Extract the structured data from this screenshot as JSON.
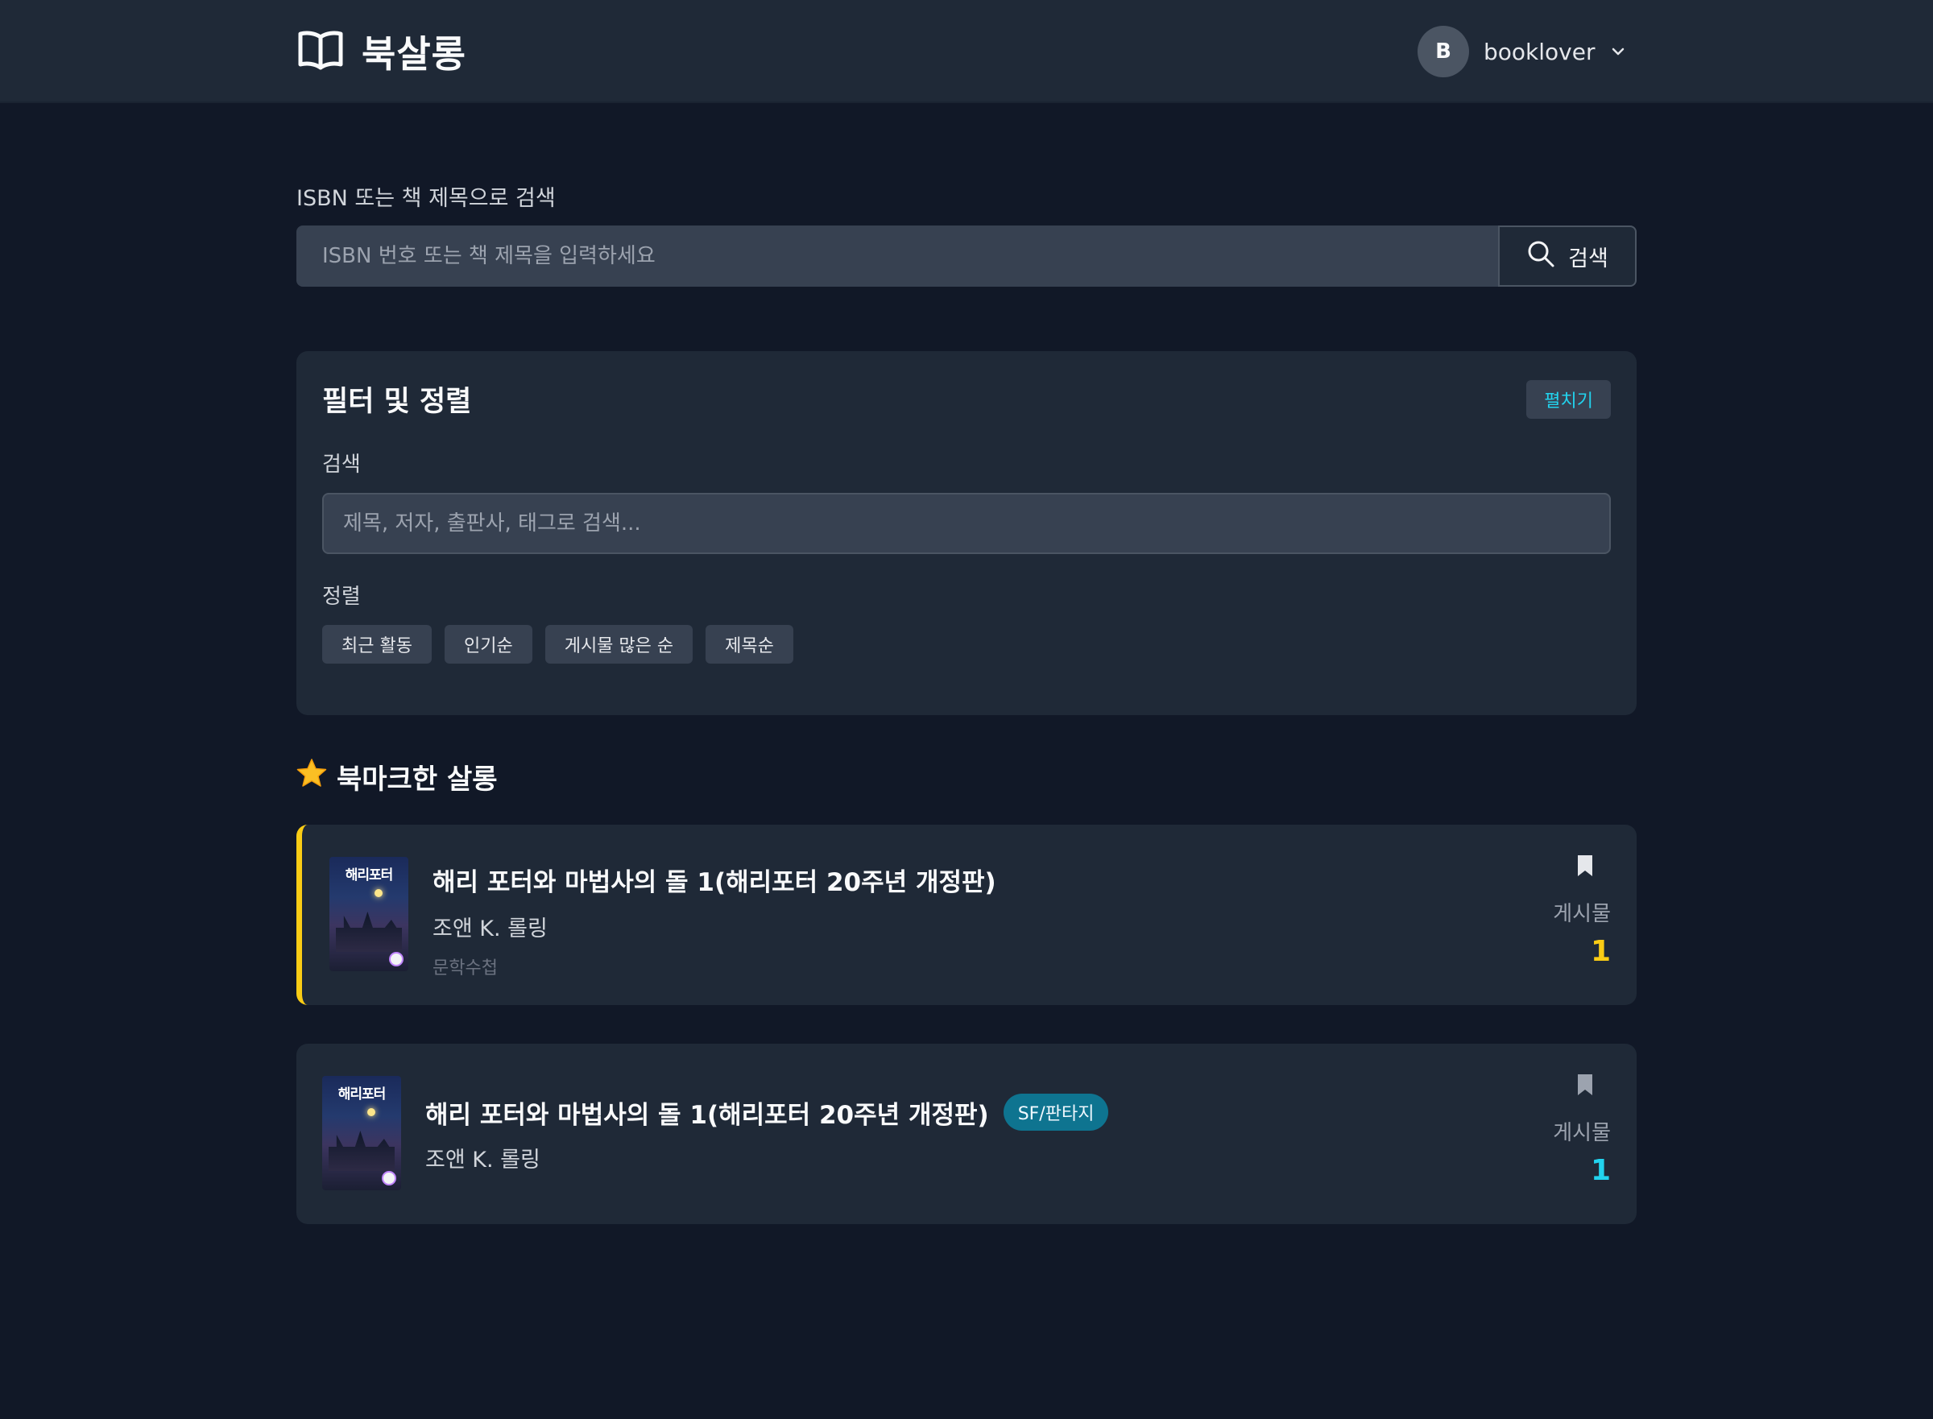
{
  "app": {
    "name": "북살롱"
  },
  "user": {
    "avatar_initial": "B",
    "name": "booklover"
  },
  "isbn_search": {
    "label": "ISBN 또는 책 제목으로 검색",
    "placeholder": "ISBN 번호 또는 책 제목을 입력하세요",
    "value": "",
    "button_label": "검색"
  },
  "filter": {
    "title": "필터 및 정렬",
    "expand_label": "펼치기",
    "search_label": "검색",
    "search_placeholder": "제목, 저자, 출판사, 태그로 검색...",
    "sort_label": "정렬",
    "sort_options": [
      "최근 활동",
      "인기순",
      "게시물 많은 순",
      "제목순"
    ]
  },
  "bookmarked_section": {
    "title": "북마크한 살롱"
  },
  "salons": [
    {
      "title": "해리 포터와 마법사의 돌 1(해리포터 20주년 개정판)",
      "author": "조앤 K. 롤링",
      "publisher": "문학수첩",
      "genre": "",
      "posts_label": "게시물",
      "posts_count": "1",
      "cover_title": "해리포터",
      "bookmarked": true
    },
    {
      "title": "해리 포터와 마법사의 돌 1(해리포터 20주년 개정판)",
      "author": "조앤 K. 롤링",
      "publisher": "",
      "genre": "SF/판타지",
      "posts_label": "게시물",
      "posts_count": "1",
      "cover_title": "해리포터",
      "bookmarked": false
    }
  ],
  "colors": {
    "background": "#111827",
    "surface": "#1f2937",
    "input": "#374151",
    "accent_cyan": "#22d3ee",
    "accent_yellow": "#facc15",
    "genre_badge": "#0e7490"
  },
  "icons": {
    "logo": "open-book-icon",
    "search": "search-icon",
    "dropdown": "chevron-down-icon",
    "section": "star-icon",
    "bookmark": "bookmark-icon"
  }
}
